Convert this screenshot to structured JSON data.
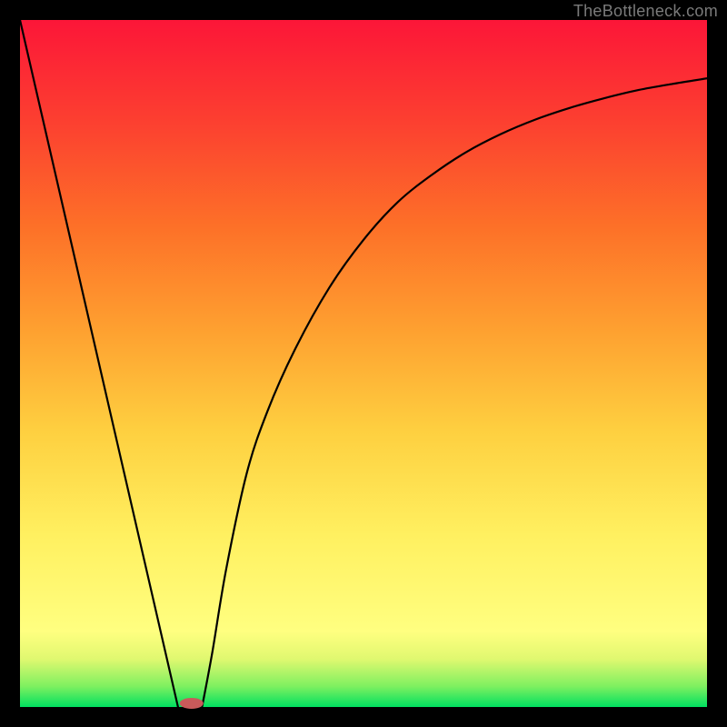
{
  "watermark": {
    "text": "TheBottleneck.com"
  },
  "chart_data": {
    "type": "line",
    "title": "",
    "xlabel": "",
    "ylabel": "",
    "xlim": [
      0,
      100
    ],
    "ylim": [
      0,
      100
    ],
    "series": [
      {
        "name": "left-segment",
        "x": [
          0,
          23
        ],
        "values": [
          100,
          0
        ]
      },
      {
        "name": "right-segment",
        "x": [
          26.5,
          28,
          30,
          33,
          36,
          40,
          45,
          50,
          55,
          60,
          65,
          70,
          75,
          80,
          85,
          90,
          95,
          100
        ],
        "values": [
          0,
          8,
          20,
          34,
          43,
          52,
          61,
          68,
          73.5,
          77.5,
          80.8,
          83.4,
          85.5,
          87.2,
          88.6,
          89.8,
          90.7,
          91.5
        ]
      }
    ],
    "marker": {
      "x_center": 25,
      "y": 0.5,
      "width_pct": 3.5,
      "height_pct": 1.6
    },
    "colors": {
      "line": "#000000",
      "marker": "#c95a5a"
    }
  }
}
